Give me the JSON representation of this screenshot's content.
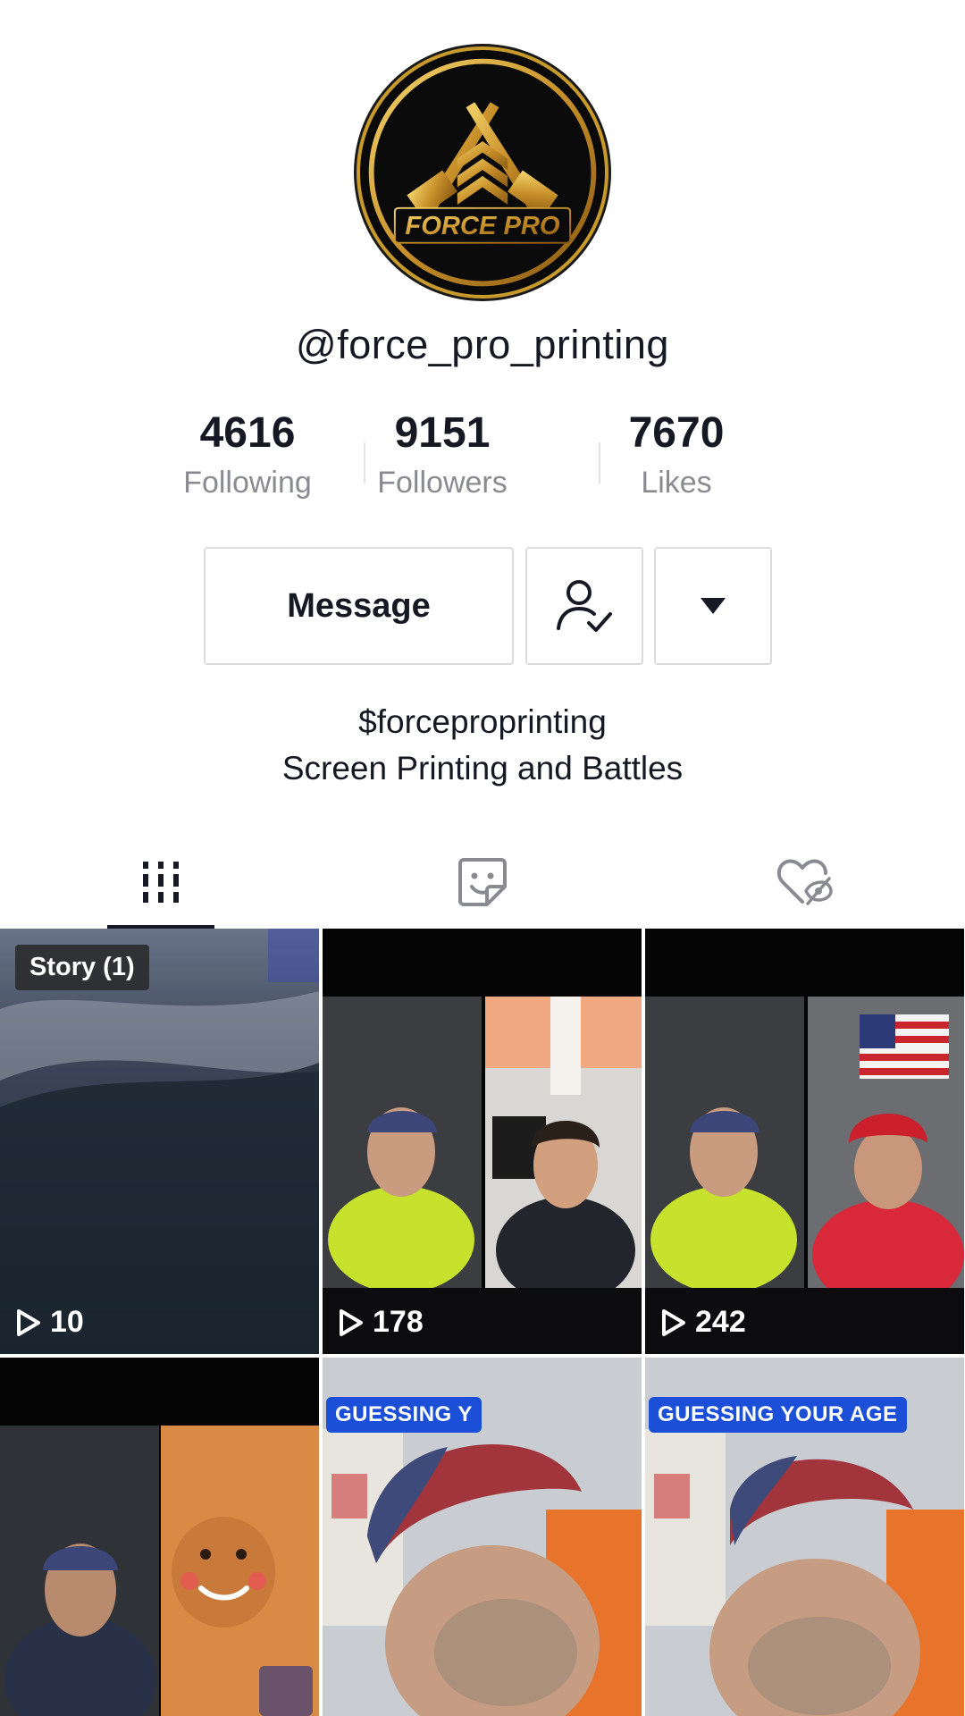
{
  "profile": {
    "username": "@force_pro_printing",
    "avatar_text": "FORCE PRO",
    "stats": {
      "following_count": "4616",
      "following_label": "Following",
      "followers_count": "9151",
      "followers_label": "Followers",
      "likes_count": "7670",
      "likes_label": "Likes"
    },
    "actions": {
      "message_label": "Message",
      "friend_icon": "person-check-icon",
      "more_icon": "caret-down-icon"
    },
    "bio_line1": "$forceproprinting",
    "bio_line2": "Screen Printing and Battles"
  },
  "tabs": [
    {
      "icon": "grid-videos-icon",
      "active": true
    },
    {
      "icon": "sticker-face-icon",
      "active": false
    },
    {
      "icon": "liked-hidden-icon",
      "active": false
    }
  ],
  "videos": [
    {
      "badge": "Story (1)",
      "views": "10"
    },
    {
      "views": "178"
    },
    {
      "views": "242"
    },
    {},
    {
      "overlay_text": "GUESSING Y"
    },
    {
      "overlay_text": "GUESSING YOUR AGE"
    }
  ],
  "colors": {
    "text": "#161823",
    "muted": "#8a8b91",
    "accent_gold": "#c89a2c",
    "tag_blue": "#1c4fd8"
  }
}
